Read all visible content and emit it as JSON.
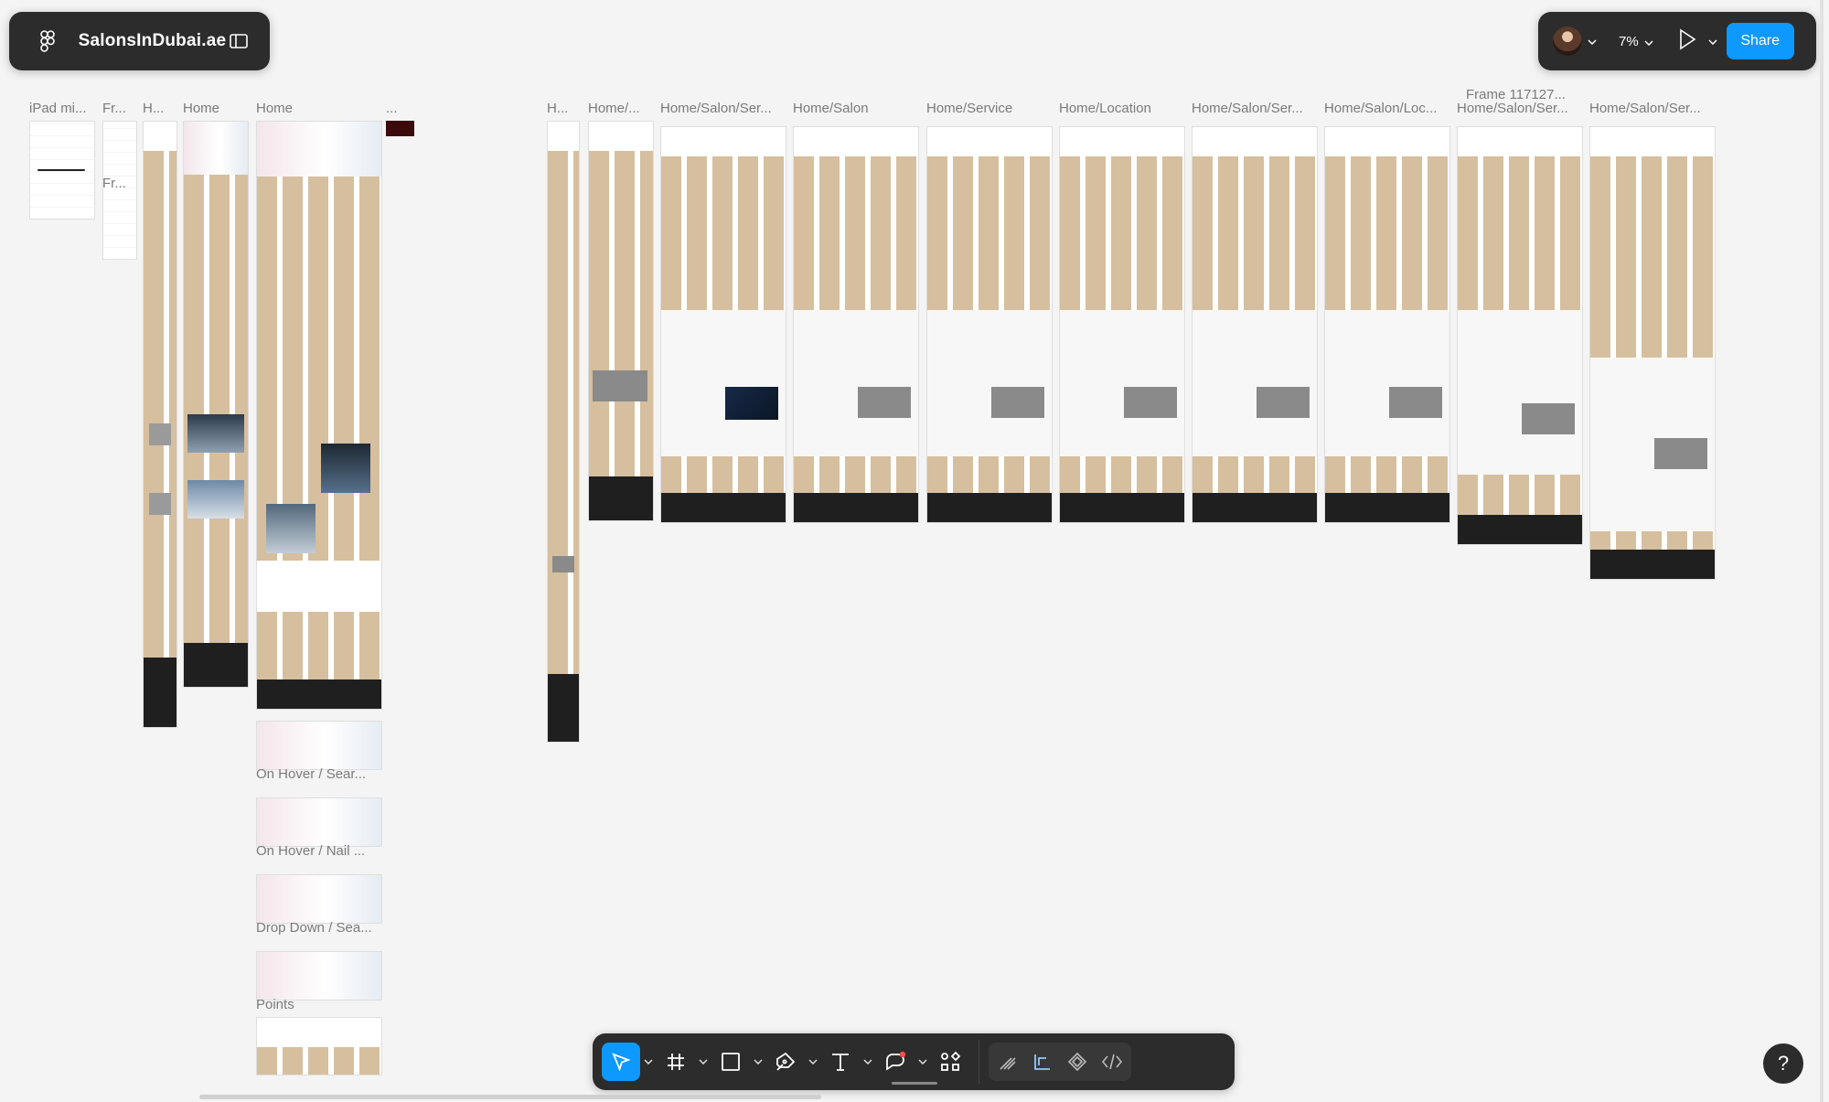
{
  "app": {
    "file_name": "SalonsInDubai.ae",
    "zoom": "7%",
    "share_label": "Share",
    "help_label": "?"
  },
  "icons": {
    "logo": "figma-logo-icon",
    "sidebar_toggle": "sidebar-toggle-icon",
    "chevron": "chevron-down-icon",
    "play": "play-icon",
    "move": "move-cursor-icon",
    "frame": "frame-hash-icon",
    "rectangle": "rectangle-icon",
    "pen": "pen-icon",
    "text": "text-icon",
    "shape": "shape-bubble-icon",
    "actions": "actions-grid-icon",
    "draw": "draw-mode-icon",
    "design": "design-mode-icon",
    "component": "component-diamond-icon",
    "dev": "dev-mode-code-icon"
  },
  "colors": {
    "accent": "#0d99ff",
    "panel": "#2c2c2c",
    "canvas": "#f4f4f4"
  },
  "frames": {
    "labels": [
      "iPad mi...",
      "Fr...",
      "H...",
      "Home",
      "Home",
      "...",
      "H...",
      "Home/...",
      "Home/Salon/Ser...",
      "Home/Salon",
      "Home/Service",
      "Home/Location",
      "Home/Salon/Ser...",
      "Home/Salon/Loc...",
      "Frame 117127...",
      "Home/Salon/Ser...",
      "Home/Salon/Ser..."
    ],
    "sublabels": [
      "On Hover / Sear...",
      "On Hover / Nail ...",
      "Drop Down / Sea...",
      "Points"
    ],
    "inline_label": "Fr..."
  }
}
